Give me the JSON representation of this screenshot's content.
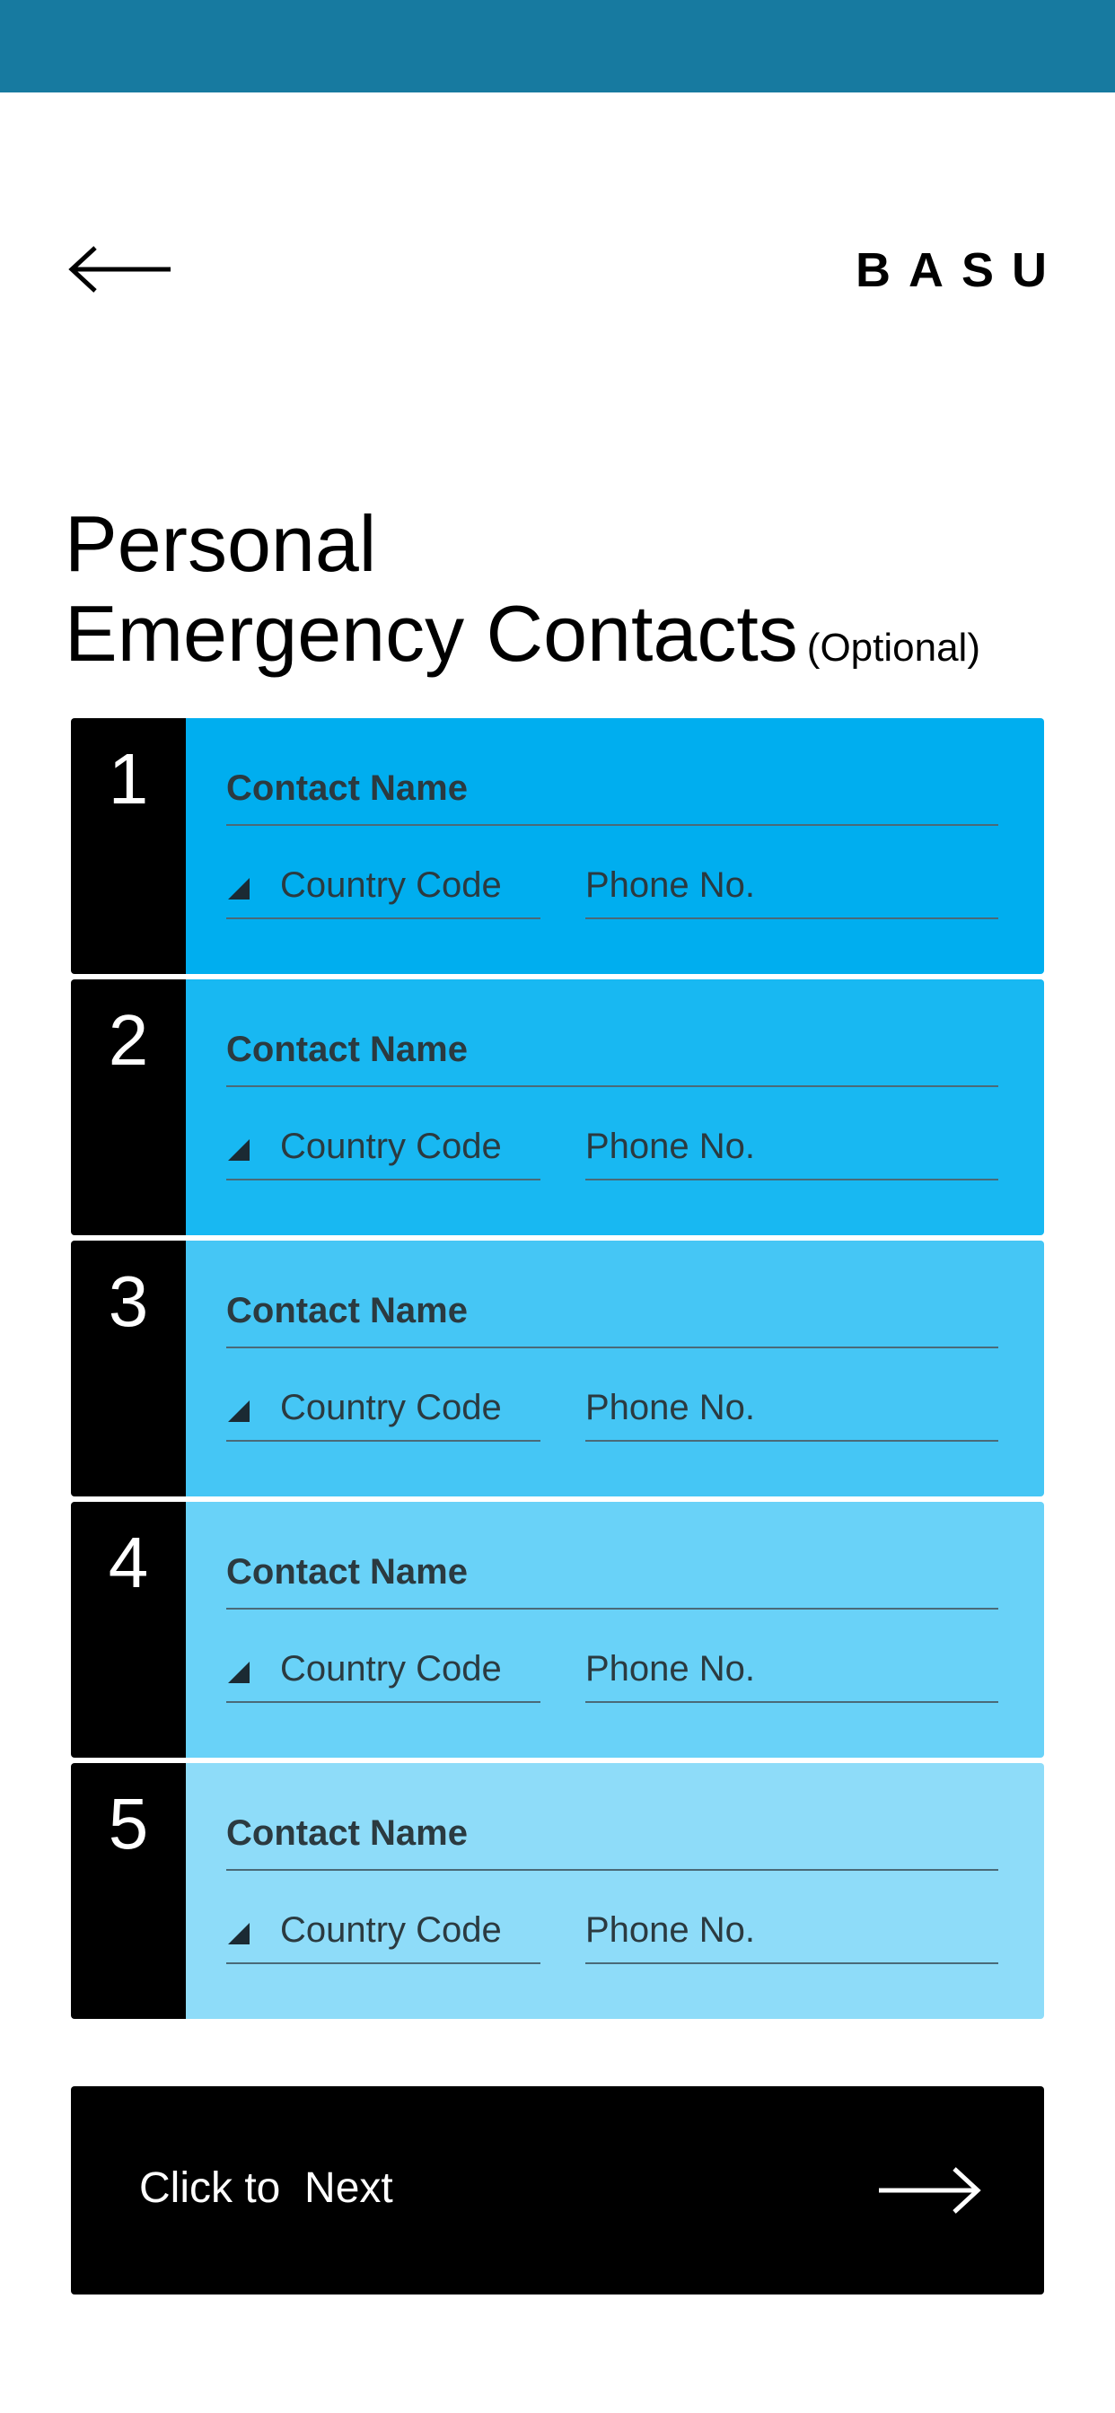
{
  "header": {
    "brand": "BASU"
  },
  "title": {
    "line1": "Personal",
    "line2": "Emergency Contacts",
    "optional": "(Optional)"
  },
  "contacts": [
    {
      "number": "1",
      "name_placeholder": "Contact Name",
      "country_code_placeholder": "Country Code",
      "phone_placeholder": "Phone No.",
      "color": "#00aeef"
    },
    {
      "number": "2",
      "name_placeholder": "Contact Name",
      "country_code_placeholder": "Country Code",
      "phone_placeholder": "Phone No.",
      "color": "#18b8f2"
    },
    {
      "number": "3",
      "name_placeholder": "Contact Name",
      "country_code_placeholder": "Country Code",
      "phone_placeholder": "Phone No.",
      "color": "#45c6f5"
    },
    {
      "number": "4",
      "name_placeholder": "Contact Name",
      "country_code_placeholder": "Country Code",
      "phone_placeholder": "Phone No.",
      "color": "#69d2f8"
    },
    {
      "number": "5",
      "name_placeholder": "Contact Name",
      "country_code_placeholder": "Country Code",
      "phone_placeholder": "Phone No.",
      "color": "#8edcf9"
    }
  ],
  "next_button": {
    "label": "Click to  Next"
  },
  "colors": {
    "status_bar": "#177aa0",
    "button_bg": "#000000"
  },
  "icons": {
    "back": "arrow-left-icon",
    "next": "arrow-right-icon",
    "dropdown": "dropdown-triangle-icon"
  }
}
